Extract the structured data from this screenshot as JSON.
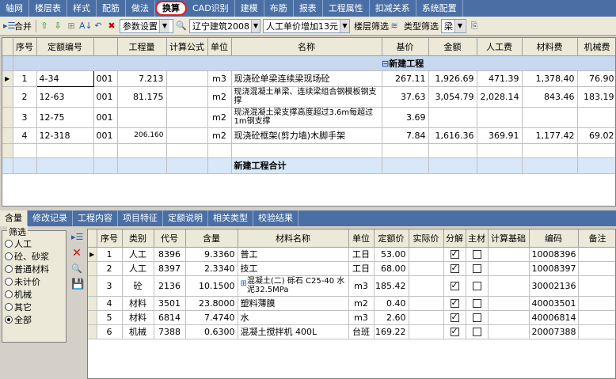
{
  "top_tabs": [
    "轴网",
    "楼层表",
    "样式",
    "配筋",
    "做法",
    "换算",
    "CAD识别",
    "建模",
    "布筋",
    "报表",
    "工程属性",
    "扣减关系",
    "系统配置"
  ],
  "active_top_tab": "换算",
  "toolbar": {
    "merge_label": "合并",
    "params_label": "参数设置",
    "quota_combo": "辽宁建筑2008",
    "price_combo": "人工单价增加13元",
    "floor_filter_label": "楼层筛选",
    "type_filter_label": "类型筛选",
    "type_filter_value": "梁"
  },
  "upper_grid": {
    "headers": [
      "序号",
      "定额编号",
      "",
      "工程量",
      "计算公式",
      "单位",
      "名称",
      "基价",
      "金额",
      "人工费",
      "材料费",
      "机械费"
    ],
    "group_label": "新建工程",
    "rows": [
      {
        "seq": "1",
        "code": "4-34",
        "sub": "001",
        "qty": "7.213",
        "formula": "",
        "unit": "m3",
        "name": "现浇砼单梁连续梁现场砼",
        "base": "267.11",
        "amount": "1,926.69",
        "labor": "471.39",
        "material": "1,378.40",
        "machine": "76.90"
      },
      {
        "seq": "2",
        "code": "12-63",
        "sub": "001",
        "qty": "81.175",
        "formula": "",
        "unit": "m2",
        "name": "现浇混凝土单梁、连续梁组合钢模板钢支撑",
        "base": "37.63",
        "amount": "3,054.79",
        "labor": "2,028.14",
        "material": "843.46",
        "machine": "183.19"
      },
      {
        "seq": "3",
        "code": "12-75",
        "sub": "001",
        "qty": "",
        "formula": "",
        "unit": "m2",
        "name": "现浇混凝土梁支撑高度超过3.6m每超过1m钢支撑",
        "base": "3.69",
        "amount": "",
        "labor": "",
        "material": "",
        "machine": ""
      },
      {
        "seq": "4",
        "code": "12-318",
        "sub": "001",
        "qty": "206.160",
        "formula": "",
        "unit": "m2",
        "name": "现浇砼框架(剪力墙)木脚手架",
        "base": "7.84",
        "amount": "1,616.36",
        "labor": "369.91",
        "material": "1,177.42",
        "machine": "69.02"
      }
    ],
    "sum_label": "新建工程合计"
  },
  "bottom_tabs": [
    "含量",
    "修改记录",
    "工程内容",
    "项目特征",
    "定额说明",
    "相关类型",
    "校验结果"
  ],
  "active_bottom_tab": "含量",
  "filter": {
    "title": "筛选",
    "options": [
      "人工",
      "砼、砂浆",
      "普通材料",
      "未计价",
      "机械",
      "其它",
      "全部"
    ],
    "selected": "全部"
  },
  "lower_grid": {
    "headers": [
      "序号",
      "类别",
      "代号",
      "含量",
      "材料名称",
      "单位",
      "定额价",
      "实际价",
      "分解",
      "主材",
      "计算基础",
      "编码",
      "备注"
    ],
    "rows": [
      {
        "seq": "1",
        "cat": "人工",
        "code": "8396",
        "content": "9.3360",
        "name": "普工",
        "unit": "工日",
        "price": "53.00",
        "actual": "",
        "split": true,
        "main": false,
        "basis": "",
        "bm": "10008396",
        "note": ""
      },
      {
        "seq": "2",
        "cat": "人工",
        "code": "8397",
        "content": "2.3340",
        "name": "技工",
        "unit": "工日",
        "price": "68.00",
        "actual": "",
        "split": true,
        "main": false,
        "basis": "",
        "bm": "10008397",
        "note": ""
      },
      {
        "seq": "3",
        "cat": "砼",
        "code": "2136",
        "content": "10.1500",
        "name": "混凝土(二) 砾石 C25-40 水泥32.5MPa",
        "unit": "m3",
        "price": "185.42",
        "actual": "",
        "split": true,
        "main": false,
        "basis": "",
        "bm": "30002136",
        "note": ""
      },
      {
        "seq": "4",
        "cat": "材料",
        "code": "3501",
        "content": "23.8000",
        "name": "塑料薄膜",
        "unit": "m2",
        "price": "0.40",
        "actual": "",
        "split": true,
        "main": false,
        "basis": "",
        "bm": "40003501",
        "note": ""
      },
      {
        "seq": "5",
        "cat": "材料",
        "code": "6814",
        "content": "7.4740",
        "name": "水",
        "unit": "m3",
        "price": "2.60",
        "actual": "",
        "split": true,
        "main": false,
        "basis": "",
        "bm": "40006814",
        "note": ""
      },
      {
        "seq": "6",
        "cat": "机械",
        "code": "7388",
        "content": "0.6300",
        "name": "混凝土搅拌机 400L",
        "unit": "台班",
        "price": "169.22",
        "actual": "",
        "split": true,
        "main": false,
        "basis": "",
        "bm": "20007388",
        "note": ""
      }
    ]
  },
  "colors": {
    "tab_bar": "#4a6fa5",
    "group_row": "#c8d8ee",
    "active_tab_outline": "#e02020"
  }
}
